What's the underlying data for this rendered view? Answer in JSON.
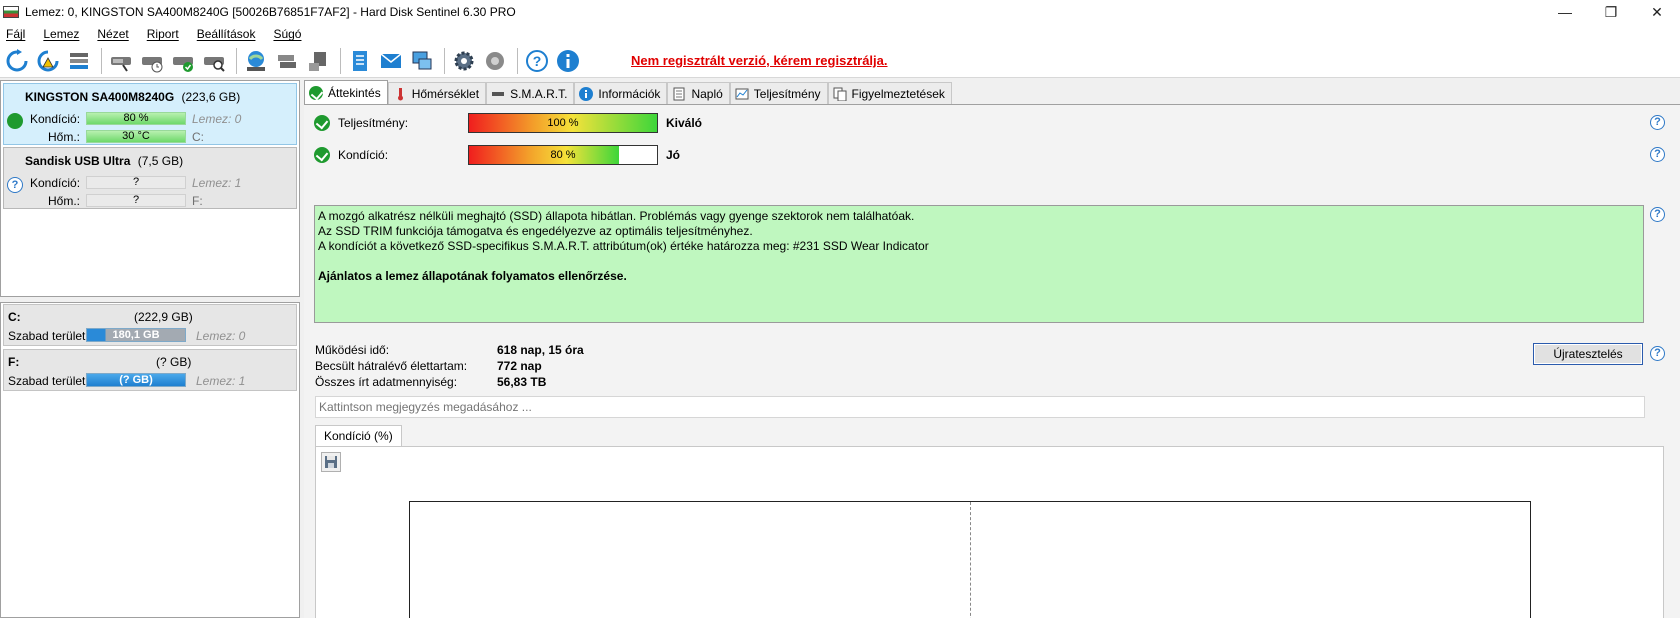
{
  "window": {
    "title": "Lemez: 0, KINGSTON SA400M8240G [50026B76851F7AF2]  -  Hard Disk Sentinel 6.30 PRO",
    "controls": [
      "minimize-icon",
      "restore-icon",
      "close-icon"
    ]
  },
  "menu": [
    "Fájl",
    "Lemez",
    "Nézet",
    "Riport",
    "Beállítások",
    "Súgó"
  ],
  "toolbar": {
    "icons": [
      "refresh-icon",
      "refresh-warning-icon",
      "disk-list-icon",
      "disk-test-icon",
      "disk-schedule-icon",
      "disk-ok-icon",
      "disk-search-icon",
      "network-globe-icon",
      "disk-network-icon",
      "usb-disk-icon",
      "report-icon",
      "email-icon",
      "monitor-network-icon",
      "settings-gear-icon",
      "sound-icon",
      "help-icon",
      "info-icon"
    ],
    "register_link": "Nem regisztrált verzió, kérem regisztrálja."
  },
  "disks": [
    {
      "name": "KINGSTON SA400M8240G",
      "size": "(223,6 GB)",
      "condition_label": "Kondíció:",
      "condition_value": "80 %",
      "condition_pct": 80,
      "temp_label": "Hőm.:",
      "temp_value": "30 °C",
      "disk_ref": "Lemez: 0",
      "drive": "C:",
      "status": "ok"
    },
    {
      "name": "Sandisk USB Ultra",
      "size": "(7,5 GB)",
      "condition_label": "Kondíció:",
      "condition_value": "?",
      "temp_label": "Hőm.:",
      "temp_value": "?",
      "disk_ref": "Lemez: 1",
      "drive": "F:",
      "status": "unknown"
    }
  ],
  "volumes": [
    {
      "drive": "C:",
      "size": "(222,9 GB)",
      "free_label": "Szabad terület",
      "free_value": "180,1 GB",
      "free_pct": 80.8,
      "disk_ref": "Lemez: 0"
    },
    {
      "drive": "F:",
      "size": "(? GB)",
      "free_label": "Szabad terület",
      "free_value": "(? GB)",
      "free_pct": 100,
      "disk_ref": "Lemez: 1"
    }
  ],
  "tabs": [
    "Áttekintés",
    "Hőmérséklet",
    "S.M.A.R.T.",
    "Információk",
    "Napló",
    "Teljesítmény",
    "Figyelmeztetések"
  ],
  "overview": {
    "performance": {
      "label": "Teljesítmény:",
      "value": "100 %",
      "pct": 100,
      "rating": "Kiváló"
    },
    "condition": {
      "label": "Kondíció:",
      "value": "80 %",
      "pct": 80,
      "rating": "Jó"
    },
    "status_lines": [
      "A mozgó alkatrész nélküli meghajtó (SSD) állapota hibátlan. Problémás vagy gyenge szektorok nem találhatóak.",
      "Az SSD TRIM funkciója támogatva és engedélyezve az optimális teljesítményhez.",
      "A kondíciót a következő SSD-specifikus S.M.A.R.T. attribútum(ok) értéke határozza meg:  #231 SSD Wear Indicator"
    ],
    "recommendation": "Ajánlatos a lemez állapotának folyamatos ellenőrzése.",
    "uptime_label": "Működési idő:",
    "uptime_value": "618 nap, 15 óra",
    "remaining_label": "Becsült hátralévő élettartam:",
    "remaining_value": "772 nap",
    "written_label": "Összes írt adatmennyiség:",
    "written_value": "56,83 TB",
    "retest_button": "Újratesztelés",
    "note_placeholder": "Kattintson megjegyzés megadásához ...",
    "chart_tab": "Kondíció  (%)"
  },
  "colors": {
    "selected_disk_bg": "#d5effc",
    "status_box_bg": "#bff7bf",
    "register_link": "#e00000",
    "ok_green": "#1f9a2f",
    "help_blue": "#2f79c7"
  }
}
